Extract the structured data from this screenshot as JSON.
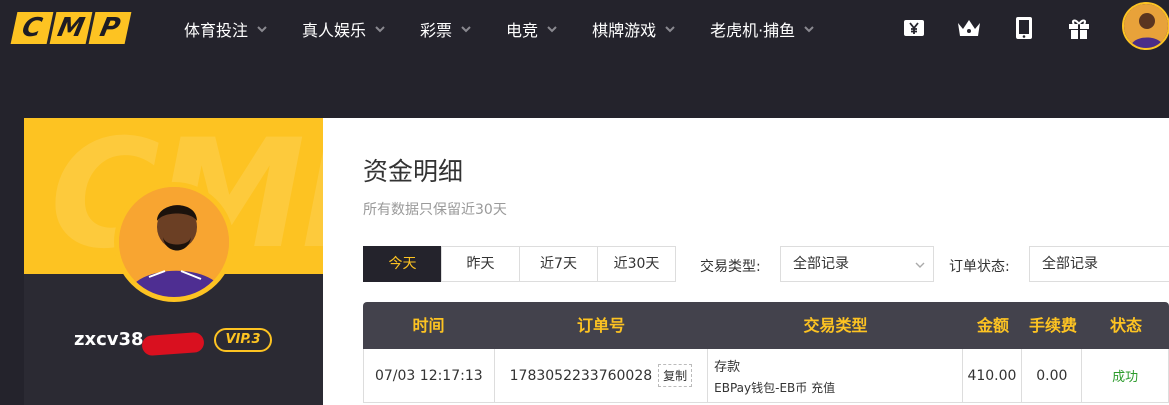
{
  "logo": {
    "letters": [
      "C",
      "M",
      "P"
    ]
  },
  "nav": {
    "items": [
      {
        "label": "体育投注"
      },
      {
        "label": "真人娱乐"
      },
      {
        "label": "彩票"
      },
      {
        "label": "电竞"
      },
      {
        "label": "棋牌游戏"
      },
      {
        "label": "老虎机·捕鱼"
      }
    ]
  },
  "header_icons": [
    "yuan-icon",
    "crown-icon",
    "tablet-icon",
    "gift-icon"
  ],
  "profile": {
    "watermark": "CMP",
    "username": "zxcv38",
    "vip": "VIP.3"
  },
  "main": {
    "title": "资金明细",
    "subtitle": "所有数据只保留近30天",
    "date_tabs": [
      {
        "label": "今天",
        "active": true
      },
      {
        "label": "昨天",
        "active": false
      },
      {
        "label": "近7天",
        "active": false
      },
      {
        "label": "近30天",
        "active": false
      }
    ],
    "filters": {
      "type_label": "交易类型:",
      "type_value": "全部记录",
      "status_label": "订单状态:",
      "status_value": "全部记录"
    },
    "table": {
      "headers": [
        "时间",
        "订单号",
        "交易类型",
        "金额",
        "手续费",
        "状态"
      ],
      "rows": [
        {
          "time": "07/03 12:17:13",
          "order_no": "1783052233760028",
          "copy_label": "复制",
          "type_main": "存款",
          "type_sub": "EBPay钱包-EB币 充值",
          "amount": "410.00",
          "fee": "0.00",
          "status": "成功"
        }
      ]
    }
  },
  "colors": {
    "accent": "#fdc322",
    "dark_bg": "#24232c",
    "header_row": "#43424c",
    "success": "#2b9b2b"
  }
}
